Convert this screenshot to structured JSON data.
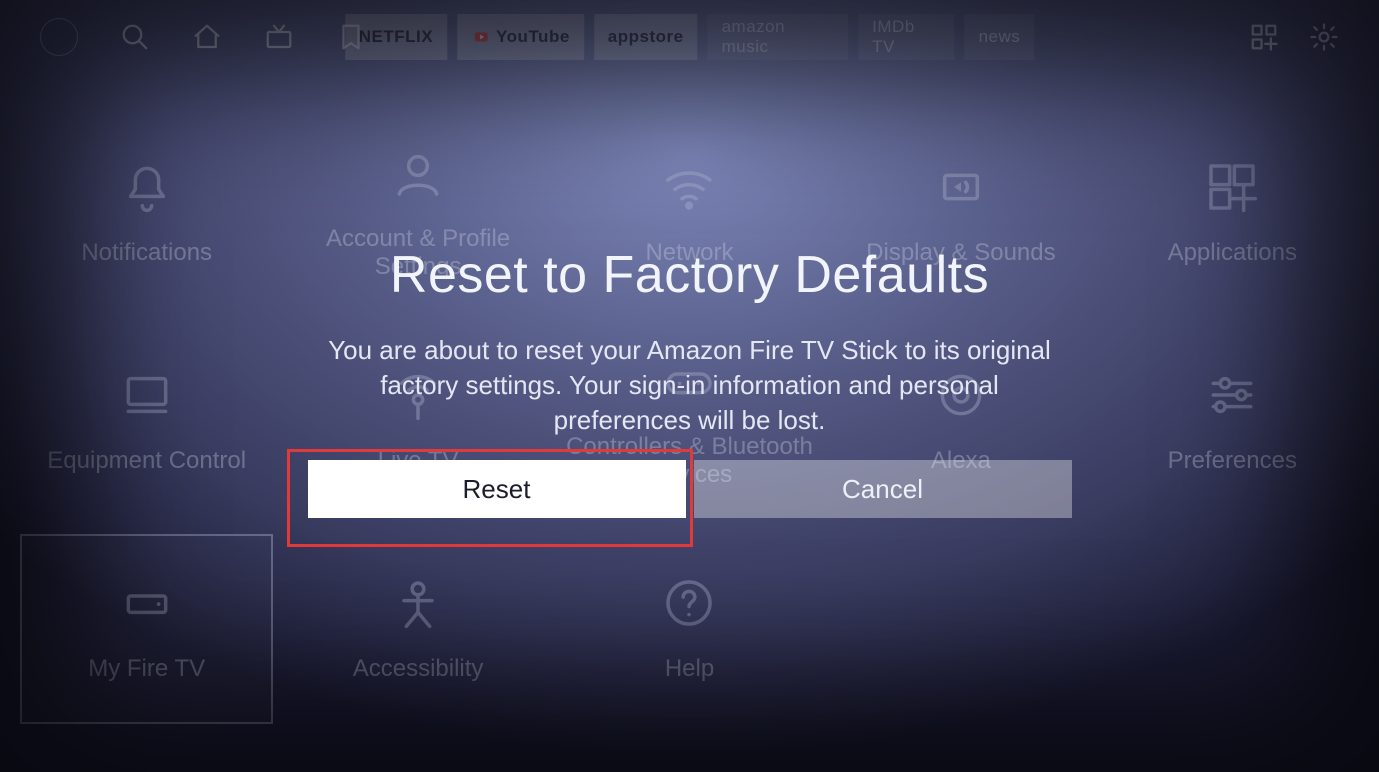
{
  "topbar": {
    "chips": [
      {
        "label": "NETFLIX",
        "style": "solid"
      },
      {
        "label": "YouTube",
        "style": "solid"
      },
      {
        "label": "appstore",
        "style": "solid"
      },
      {
        "label": "amazon music",
        "style": "ghost"
      },
      {
        "label": "IMDb TV",
        "style": "ghost"
      },
      {
        "label": "news",
        "style": "ghost"
      }
    ]
  },
  "settingsGrid": {
    "tiles": [
      {
        "label": "Notifications",
        "icon": "bell"
      },
      {
        "label": "Account & Profile Settings",
        "icon": "user"
      },
      {
        "label": "Network",
        "icon": "wifi"
      },
      {
        "label": "Display & Sounds",
        "icon": "speaker"
      },
      {
        "label": "Applications",
        "icon": "apps"
      },
      {
        "label": "Equipment Control",
        "icon": "monitor"
      },
      {
        "label": "Live TV",
        "icon": "antenna"
      },
      {
        "label": "Controllers & Bluetooth Devices",
        "icon": "controller"
      },
      {
        "label": "Alexa",
        "icon": "ring"
      },
      {
        "label": "Preferences",
        "icon": "sliders"
      },
      {
        "label": "My Fire TV",
        "icon": "box",
        "selected": true
      },
      {
        "label": "Accessibility",
        "icon": "person"
      },
      {
        "label": "Help",
        "icon": "help"
      }
    ]
  },
  "dialog": {
    "title": "Reset to Factory Defaults",
    "body": "You are about to reset your Amazon Fire TV Stick to its original factory settings. Your sign-in information and personal preferences will be lost.",
    "primary": "Reset",
    "secondary": "Cancel"
  }
}
